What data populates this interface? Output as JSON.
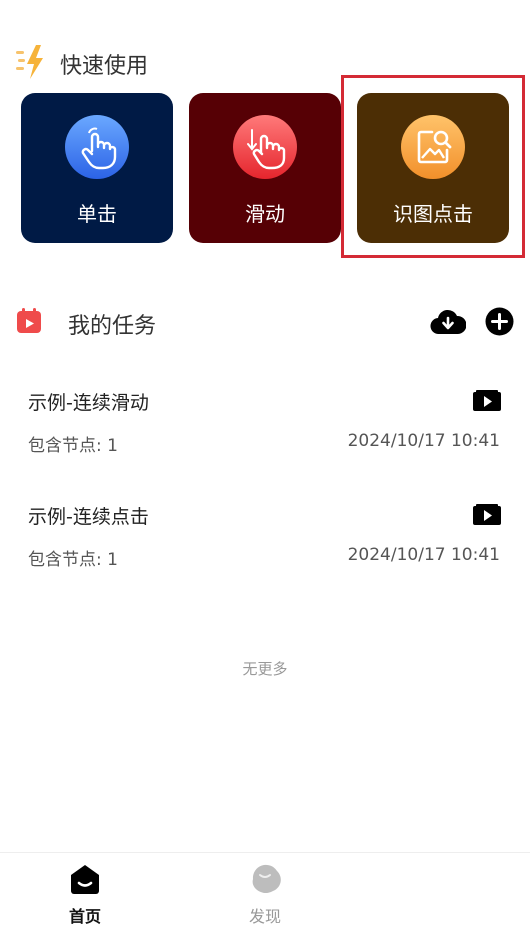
{
  "quick": {
    "title": "快速使用",
    "cards": [
      {
        "label": "单击",
        "icon": "tap-hand-icon",
        "bg": "#001a45"
      },
      {
        "label": "滑动",
        "icon": "swipe-hand-icon",
        "bg": "#560005"
      },
      {
        "label": "识图点击",
        "icon": "image-search-icon",
        "bg": "#4c2e05"
      }
    ]
  },
  "tasks": {
    "title": "我的任务",
    "items": [
      {
        "name": "示例-连续滑动",
        "nodes": "包含节点: 1",
        "time": "2024/10/17 10:41"
      },
      {
        "name": "示例-连续点击",
        "nodes": "包含节点: 1",
        "time": "2024/10/17 10:41"
      }
    ],
    "end_text": "无更多"
  },
  "tabbar": {
    "home": "首页",
    "discover": "发现"
  },
  "colors": {
    "highlight": "#d42a35",
    "lightning": "#f6b33a",
    "calendar": "#ef4b4b"
  }
}
